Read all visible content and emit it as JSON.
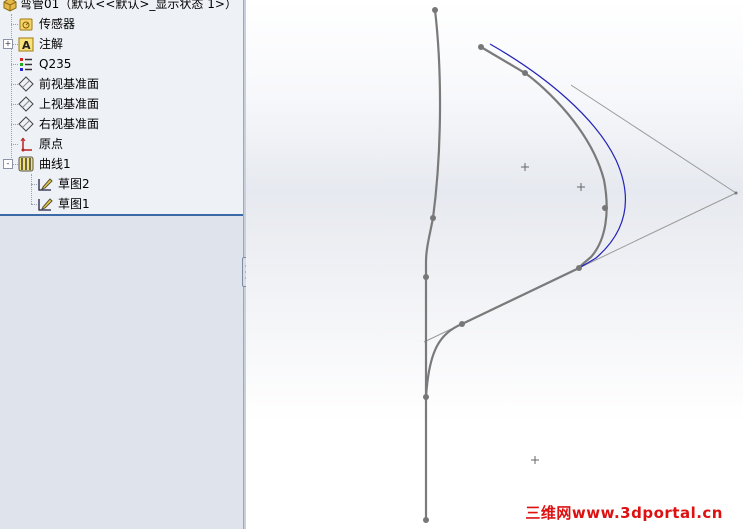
{
  "tree": {
    "root_label": "弯管01（默认<<默认>_显示状态 1>）",
    "items": [
      {
        "label": "传感器",
        "icon": "sensor-icon"
      },
      {
        "label": "注解",
        "icon": "annotation-icon"
      },
      {
        "label": "Q235",
        "icon": "material-icon"
      },
      {
        "label": "前视基准面",
        "icon": "plane-icon"
      },
      {
        "label": "上视基准面",
        "icon": "plane-icon"
      },
      {
        "label": "右视基准面",
        "icon": "plane-icon"
      },
      {
        "label": "原点",
        "icon": "origin-icon"
      },
      {
        "label": "曲线1",
        "icon": "curve-feature-icon"
      },
      {
        "label": "草图2",
        "icon": "sketch-icon"
      },
      {
        "label": "草图1",
        "icon": "sketch-icon"
      }
    ],
    "expander_collapsed": "+",
    "expander_expanded": "-"
  },
  "viewport": {
    "watermark": "三维网www.3dportal.cn",
    "colors": {
      "curve_gray": "#7a7a7a",
      "curve_blue": "#2323b8",
      "construction_line": "#9a9a9a"
    }
  }
}
